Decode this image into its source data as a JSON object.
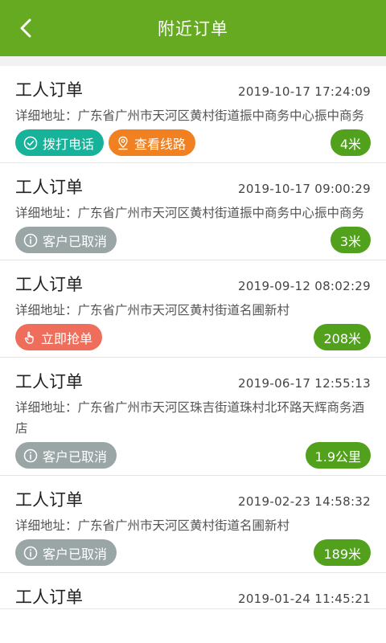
{
  "header": {
    "title": "附近订单"
  },
  "orders": [
    {
      "title": "工人订单",
      "time": "2019-10-17 17:24:09",
      "address": "详细地址：广东省广州市天河区黄村街道振中商务中心振中商务",
      "distance": "4米",
      "call_label": "拨打电话",
      "route_label": "查看线路"
    },
    {
      "title": "工人订单",
      "time": "2019-10-17 09:00:29",
      "address": "详细地址：广东省广州市天河区黄村街道振中商务中心振中商务",
      "distance": "3米",
      "status_label": "客户已取消"
    },
    {
      "title": "工人订单",
      "time": "2019-09-12 08:02:29",
      "address": "详细地址：广东省广州市天河区黄村街道名圃新村",
      "distance": "208米",
      "grab_label": "立即抢单"
    },
    {
      "title": "工人订单",
      "time": "2019-06-17 12:55:13",
      "address": "详细地址：广东省广州市天河区珠吉街道珠村北环路天辉商务酒店",
      "distance": "1.9公里",
      "status_label": "客户已取消"
    },
    {
      "title": "工人订单",
      "time": "2019-02-23 14:58:32",
      "address": "详细地址：广东省广州市天河区黄村街道名圃新村",
      "distance": "189米",
      "status_label": "客户已取消"
    },
    {
      "title": "工人订单",
      "time": "2019-01-24 11:45:21"
    }
  ],
  "colors": {
    "header": "#66aa22",
    "call": "#16b39a",
    "route": "#f08020",
    "grab": "#ef6e5b",
    "cancelled": "#9aa5a6",
    "distance": "#52a11c"
  }
}
